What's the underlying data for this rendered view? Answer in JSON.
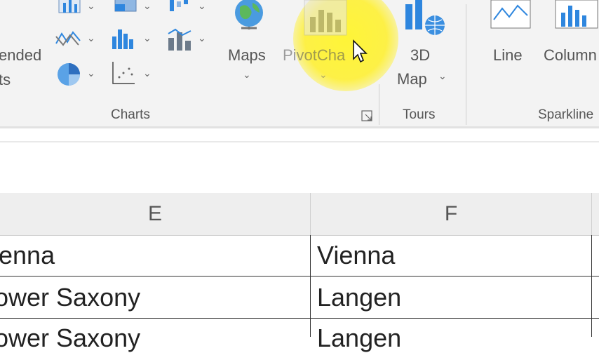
{
  "ribbon": {
    "recommended_label_line1": "ended",
    "recommended_label_line2": "ts",
    "maps_label": "Maps",
    "pivotchart_label": "PivotCha",
    "map3d_label_line1": "3D",
    "map3d_label_line2": "Map",
    "line_label": "Line",
    "column_label": "Column",
    "groups": {
      "charts": "Charts",
      "tours": "Tours",
      "sparklines": "Sparkline"
    }
  },
  "sheet": {
    "columns": [
      "E",
      "F"
    ],
    "rows": [
      [
        "enna",
        "Vienna"
      ],
      [
        "ower Saxony",
        "Langen"
      ],
      [
        "ower Saxony",
        "Langen"
      ]
    ]
  },
  "colors": {
    "highlight": "#fff228",
    "chart_blue": "#2e86de",
    "ribbon_bg": "#f3f3f3"
  }
}
